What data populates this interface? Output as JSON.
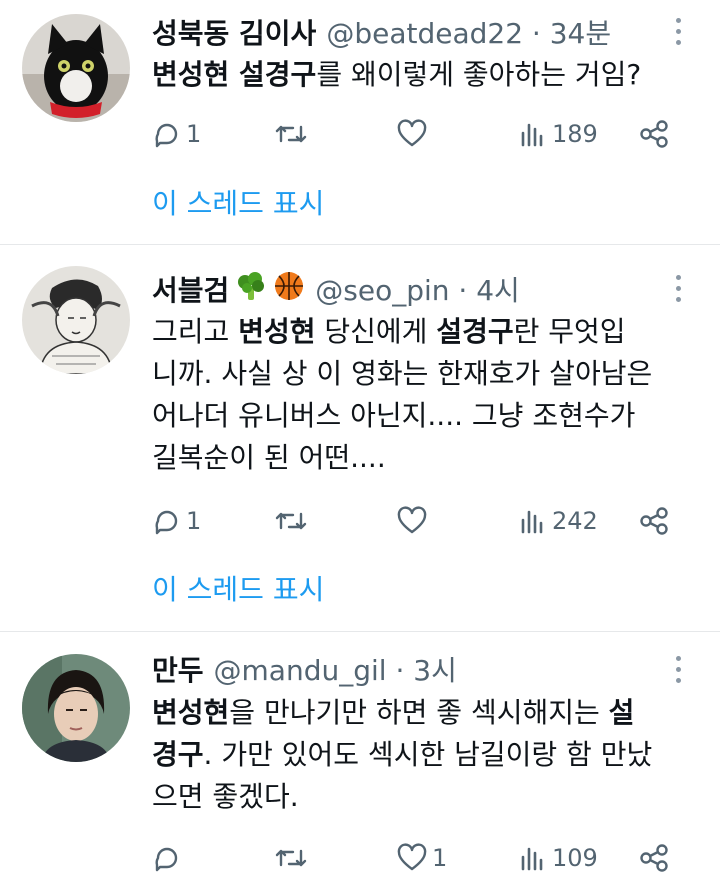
{
  "tweets": [
    {
      "name": "성북동 김이사",
      "handle": "@beatdead22 · 34분",
      "segments": [
        {
          "text": "변성현 설경구",
          "bold": true
        },
        {
          "text": "를 왜이렇게 좋아하는 거임?",
          "bold": false
        }
      ],
      "replies": "1",
      "retweets": "",
      "likes": "",
      "views": "189",
      "show_thread": "이 스레드 표시"
    },
    {
      "name": "서블검",
      "emojis": [
        "🥦",
        "🏀"
      ],
      "handle": "@seo_pin · 4시",
      "segments": [
        {
          "text": "그리고 ",
          "bold": false
        },
        {
          "text": "변성현",
          "bold": true
        },
        {
          "text": " 당신에게 ",
          "bold": false
        },
        {
          "text": "설경구",
          "bold": true
        },
        {
          "text": "란 무엇입",
          "bold": false
        },
        {
          "text": "니까. 사실 상 이 영화는 한재호가 살아남은",
          "bold": false
        },
        {
          "text": "어나더 유니버스 아닌지.... 그냥 조현수가",
          "bold": false
        },
        {
          "text": "길복순이 된 어떤....",
          "bold": false
        }
      ],
      "replies": "1",
      "retweets": "",
      "likes": "",
      "views": "242",
      "show_thread": "이 스레드 표시"
    },
    {
      "name": "만두",
      "handle": "@mandu_gil · 3시",
      "segments": [
        {
          "text": "변성현",
          "bold": true
        },
        {
          "text": "을 만나기만 하면 좋 섹시해지는 ",
          "bold": false
        },
        {
          "text": "설",
          "bold": true
        },
        {
          "text": "경구",
          "bold": true
        },
        {
          "text": ". 가만 있어도 섹시한 남길이랑 함 만났",
          "bold": false
        },
        {
          "text": "으면 좋겠다.",
          "bold": false
        }
      ],
      "replies": "",
      "retweets": "",
      "likes": "1",
      "views": "109"
    }
  ],
  "colors": {
    "accent": "#1d9bf0",
    "muted": "#536471",
    "text": "#0f1419",
    "divider": "#e6e8ea"
  },
  "icons": [
    "reply-icon",
    "retweet-icon",
    "like-icon",
    "views-icon",
    "share-icon",
    "more-icon"
  ]
}
